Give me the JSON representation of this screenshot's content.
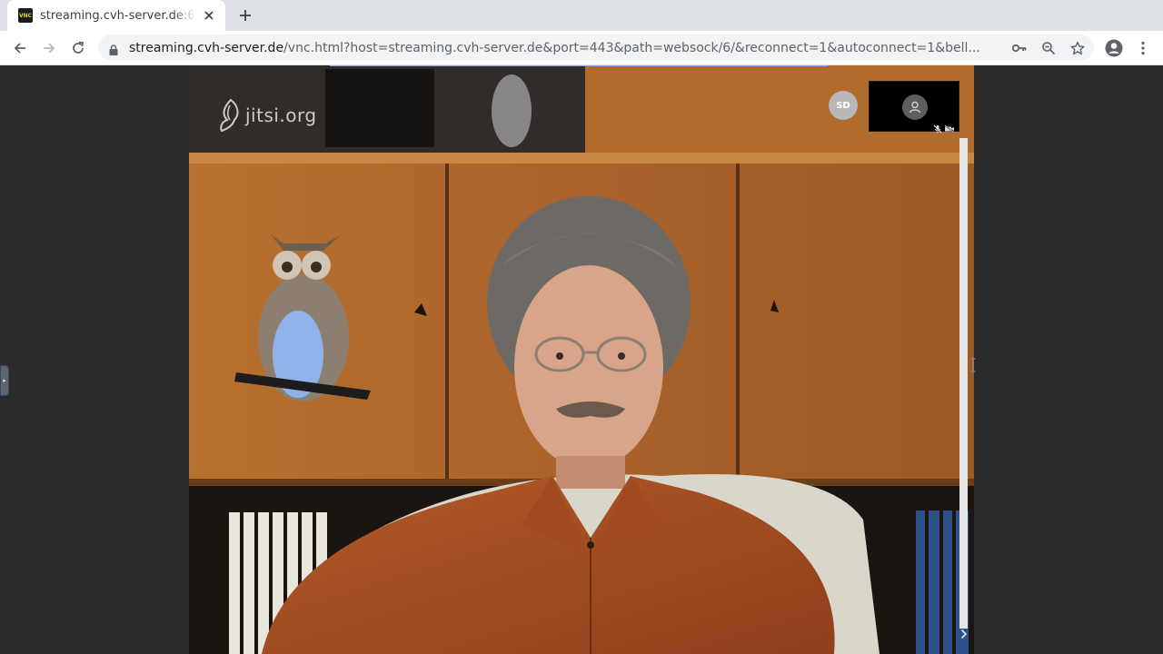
{
  "browser": {
    "tab": {
      "favicon_text": "VNC",
      "title": "streaming.cvh-server.de:6"
    },
    "url": {
      "host": "streaming.cvh-server.de",
      "rest": "/vnc.html?host=streaming.cvh-server.de&port=443&path=websock/6/&reconnect=1&autoconnect=1&bell..."
    }
  },
  "meeting": {
    "watermark": "jitsi.org",
    "avatar_initials": "SD"
  },
  "icons": {
    "back": "arrow-left-icon",
    "forward": "arrow-right-icon",
    "reload": "reload-icon",
    "lock": "lock-icon",
    "key": "key-icon",
    "zoom": "zoom-icon",
    "bookmark": "star-icon",
    "profile": "account-icon",
    "menu": "kebab-menu-icon"
  },
  "colors": {
    "tabstrip": "#dee1e6",
    "page_background": "#2b2b2b",
    "video_wood": "#b0692a"
  }
}
